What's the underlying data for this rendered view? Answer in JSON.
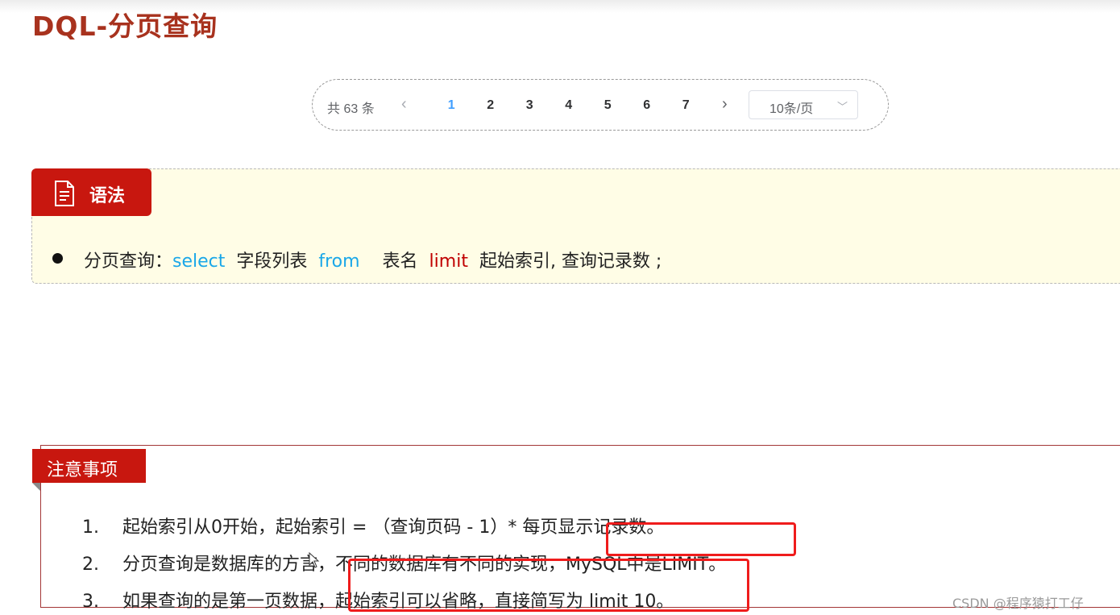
{
  "title": "DQL-分页查询",
  "pagination": {
    "total": "共 63 条",
    "pages": [
      "1",
      "2",
      "3",
      "4",
      "5",
      "6",
      "7"
    ],
    "active_page": "1",
    "page_size": "10条/页"
  },
  "syntax": {
    "tag_label": "语法",
    "line": {
      "prefix": "分页查询：",
      "kw_select": "select",
      "fields": "  字段列表  ",
      "kw_from": "from",
      "table": "    表名  ",
      "kw_limit": "limit",
      "rest": "  起始索引, 查询记录数 ;"
    }
  },
  "notes": {
    "tag_label": "注意事项",
    "items": [
      {
        "num": "1.",
        "text": "起始索引从0开始，起始索引 = （查询页码 - 1）* 每页显示记录数。"
      },
      {
        "num": "2.",
        "text": "分页查询是数据库的方言，不同的数据库有不同的实现，MySQL中是LIMIT。"
      },
      {
        "num": "3.",
        "text": "如果查询的是第一页数据，起始索引可以省略，直接简写为 limit 10。"
      }
    ]
  },
  "watermark": "CSDN @程序猿打工仔",
  "colors": {
    "title": "#a8321e",
    "tag_red": "#c8170f",
    "keyword_blue": "#1aa7e8",
    "keyword_red": "#c00000",
    "highlight_box": "#ef1c1c",
    "syntax_bg": "#fffde6",
    "active_page": "#409eff"
  }
}
